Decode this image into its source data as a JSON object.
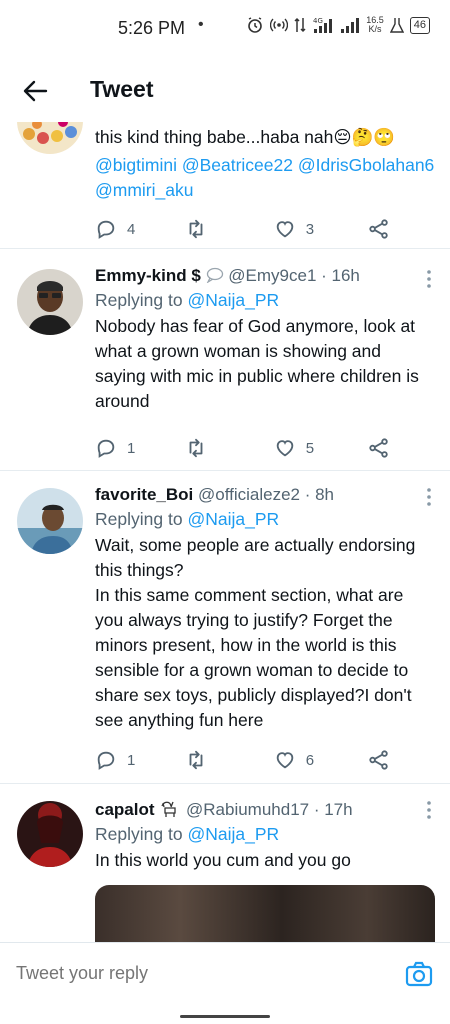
{
  "status_bar": {
    "time": "5:26 PM",
    "dot": "•",
    "network_speed_value": "16.5",
    "network_speed_unit": "K/s",
    "battery": "46"
  },
  "header": {
    "title": "Tweet"
  },
  "tweets": [
    {
      "text": "this kind thing babe...haba nah😔🤔🙄",
      "mentions": "@bigtimini @Beatricee22 @IdrisGbolahan6 @mmiri_aku",
      "replies": "4",
      "likes": "3"
    },
    {
      "name": "Emmy-kind $",
      "handle": "@Emy9ce1",
      "time": "· 16h",
      "replying_prefix": "Replying to",
      "replying_to": "@Naija_PR",
      "text": "Nobody has fear of God anymore, look at what a grown woman is showing and saying with mic in public where children is around",
      "replies": "1",
      "likes": "5"
    },
    {
      "name": "favorite_Boi",
      "handle": "@officialeze2",
      "time": "· 8h",
      "replying_prefix": "Replying to",
      "replying_to": "@Naija_PR",
      "text": "Wait, some people are actually endorsing this things?\nIn this same comment section, what are you always trying to justify? Forget the minors present, how in the world is this sensible for a grown woman to decide to share sex toys, publicly displayed?I don't see anything fun here",
      "replies": "1",
      "likes": "6"
    },
    {
      "name": "capalot",
      "handle": "@Rabiumuhd17",
      "time": "· 17h",
      "replying_prefix": "Replying to",
      "replying_to": "@Naija_PR",
      "text": "In this world you cum and you go"
    }
  ],
  "reply_bar": {
    "placeholder": "Tweet your reply"
  },
  "colors": {
    "accent": "#1d9bf0",
    "secondary_text": "#536471",
    "divider": "#e6ecf0"
  },
  "icons": [
    "back-arrow-icon",
    "more-icon",
    "reply-icon",
    "retweet-icon",
    "like-icon",
    "share-icon",
    "camera-icon"
  ]
}
